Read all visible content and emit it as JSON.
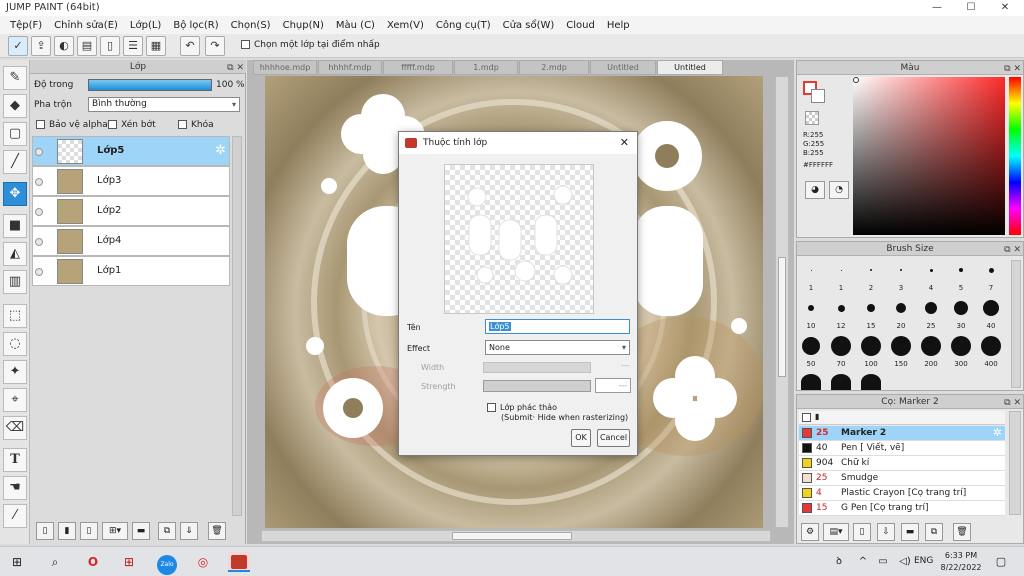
{
  "app": {
    "title": "JUMP PAINT (64bit)"
  },
  "window_controls": {
    "minimize": "—",
    "maximize": "☐",
    "close": "✕"
  },
  "menu": [
    "Tệp(F)",
    "Chỉnh sửa(E)",
    "Lớp(L)",
    "Bộ lọc(R)",
    "Chọn(S)",
    "Chụp(N)",
    "Màu (C)",
    "Xem(V)",
    "Công cụ(T)",
    "Cửa sổ(W)",
    "Cloud",
    "Help"
  ],
  "toolbar": {
    "select_layer_checkbox_label": "Chọn một lớp tại điểm nhấp"
  },
  "layer_panel": {
    "title": "Lớp",
    "opacity_label": "Độ trong",
    "opacity_value": "100 %",
    "opacity_fraction": 1.0,
    "blend_label": "Pha trộn",
    "blend_value": "Bình thường",
    "protect_alpha": "Bảo vệ alpha",
    "clipping": "Xén bớt",
    "lock": "Khóa",
    "layers": [
      {
        "name": "Lớp5",
        "selected": true
      },
      {
        "name": "Lớp3",
        "selected": false
      },
      {
        "name": "Lớp2",
        "selected": false
      },
      {
        "name": "Lớp4",
        "selected": false
      },
      {
        "name": "Lớp1",
        "selected": false
      }
    ]
  },
  "doc_tabs": [
    "hhhhoe.mdp",
    "hhhhf.mdp",
    "fffff.mdp",
    "1.mdp",
    "2.mdp",
    "Untitled",
    "Untitled"
  ],
  "dialog": {
    "title": "Thuộc tính lớp",
    "close": "✕",
    "name_label": "Tên",
    "name_value": "Lớp5",
    "effect_label": "Effect",
    "effect_value": "None",
    "width_label": "Width",
    "width_value": "---",
    "strength_label": "Strength",
    "strength_value": "---",
    "draft_label": "Lớp phác thảo",
    "draft_sublabel": "(Submit· Hide when rasterizing)",
    "ok": "OK",
    "cancel": "Cancel"
  },
  "color_panel": {
    "title": "Màu",
    "r": "R:255",
    "g": "G:255",
    "b": "B:255",
    "hex": "#FFFFFF",
    "fg_color": "#FFFFFF",
    "bg_color": "#FFFFFF"
  },
  "brush_panel": {
    "title": "Brush Size",
    "sizes": [
      "1",
      "1",
      "2",
      "3",
      "4",
      "5",
      "7",
      "10",
      "12",
      "15",
      "20",
      "25",
      "30",
      "40",
      "50",
      "70",
      "100",
      "150",
      "200",
      "300",
      "400"
    ]
  },
  "tool_panel": {
    "title": "Cọ: Marker 2",
    "tools": [
      {
        "size": "25",
        "name": "Marker 2",
        "color": "#e53935",
        "selected": true
      },
      {
        "size": "40",
        "name": "Pen [ Viết, vẽ]",
        "color": "#111111",
        "selected": false
      },
      {
        "size": "904",
        "name": "Chữ kí",
        "color": "#f1d21e",
        "selected": false
      },
      {
        "size": "25",
        "name": "Smudge",
        "color": "#f3e0d0",
        "selected": false
      },
      {
        "size": "4",
        "name": "Plastic Crayon [Cọ trang trí]",
        "color": "#f1d21e",
        "selected": false
      },
      {
        "size": "15",
        "name": "G Pen [Cọ trang trí]",
        "color": "#e53935",
        "selected": false
      }
    ]
  },
  "taskbar": {
    "time": "6:33 PM",
    "date": "8/22/2022",
    "lang": "ENG",
    "zalo": "Zalo"
  }
}
